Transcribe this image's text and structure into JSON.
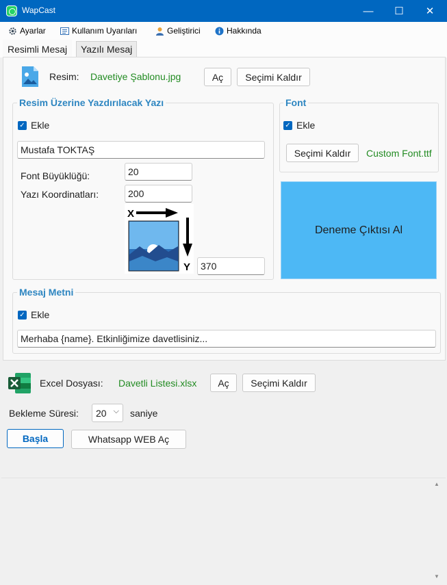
{
  "window": {
    "title": "WapCast",
    "minimize": "—",
    "maximize": "☐",
    "close": "✕"
  },
  "menu": [
    {
      "label": "Ayarlar",
      "icon": "gear-icon"
    },
    {
      "label": "Kullanım Uyarıları",
      "icon": "list-icon"
    },
    {
      "label": "Geliştirici",
      "icon": "user-icon"
    },
    {
      "label": "Hakkında",
      "icon": "info-icon"
    }
  ],
  "tabs": [
    {
      "label": "Resimli Mesaj",
      "active": true
    },
    {
      "label": "Yazılı Mesaj",
      "active": false
    }
  ],
  "image_row": {
    "label": "Resim:",
    "file": "Davetiye Şablonu.jpg",
    "open": "Aç",
    "clear": "Seçimi Kaldır"
  },
  "text_group": {
    "title": "Resim Üzerine Yazdırılacak Yazı",
    "checkbox": "Ekle",
    "checked": true,
    "text_value": "Mustafa TOKTAŞ",
    "font_size_label": "Font Büyüklüğü:",
    "font_size_value": "20",
    "coord_label": "Yazı Koordinatları:",
    "x_value": "200",
    "y_value": "370",
    "x_axis": "X",
    "y_axis": "Y"
  },
  "font_group": {
    "title": "Font",
    "checkbox": "Ekle",
    "checked": true,
    "clear": "Seçimi Kaldır",
    "file": "Custom Font.ttf"
  },
  "preview_button": "Deneme Çıktısı Al",
  "message_group": {
    "title": "Mesaj Metni",
    "checkbox": "Ekle",
    "checked": true,
    "text_value": "Merhaba {name}. Etkinliğimize davetlisiniz..."
  },
  "excel_row": {
    "label": "Excel Dosyası:",
    "file": "Davetli Listesi.xlsx",
    "open": "Aç",
    "clear": "Seçimi Kaldır"
  },
  "wait_row": {
    "label": "Bekleme Süresi:",
    "value": "20",
    "unit": "saniye"
  },
  "actions": {
    "start": "Başla",
    "whatsapp": "Whatsapp WEB Aç"
  },
  "colors": {
    "accent": "#0067c0",
    "group_title": "#2e86c1",
    "file_text": "#228b22",
    "preview": "#4db8f5"
  }
}
